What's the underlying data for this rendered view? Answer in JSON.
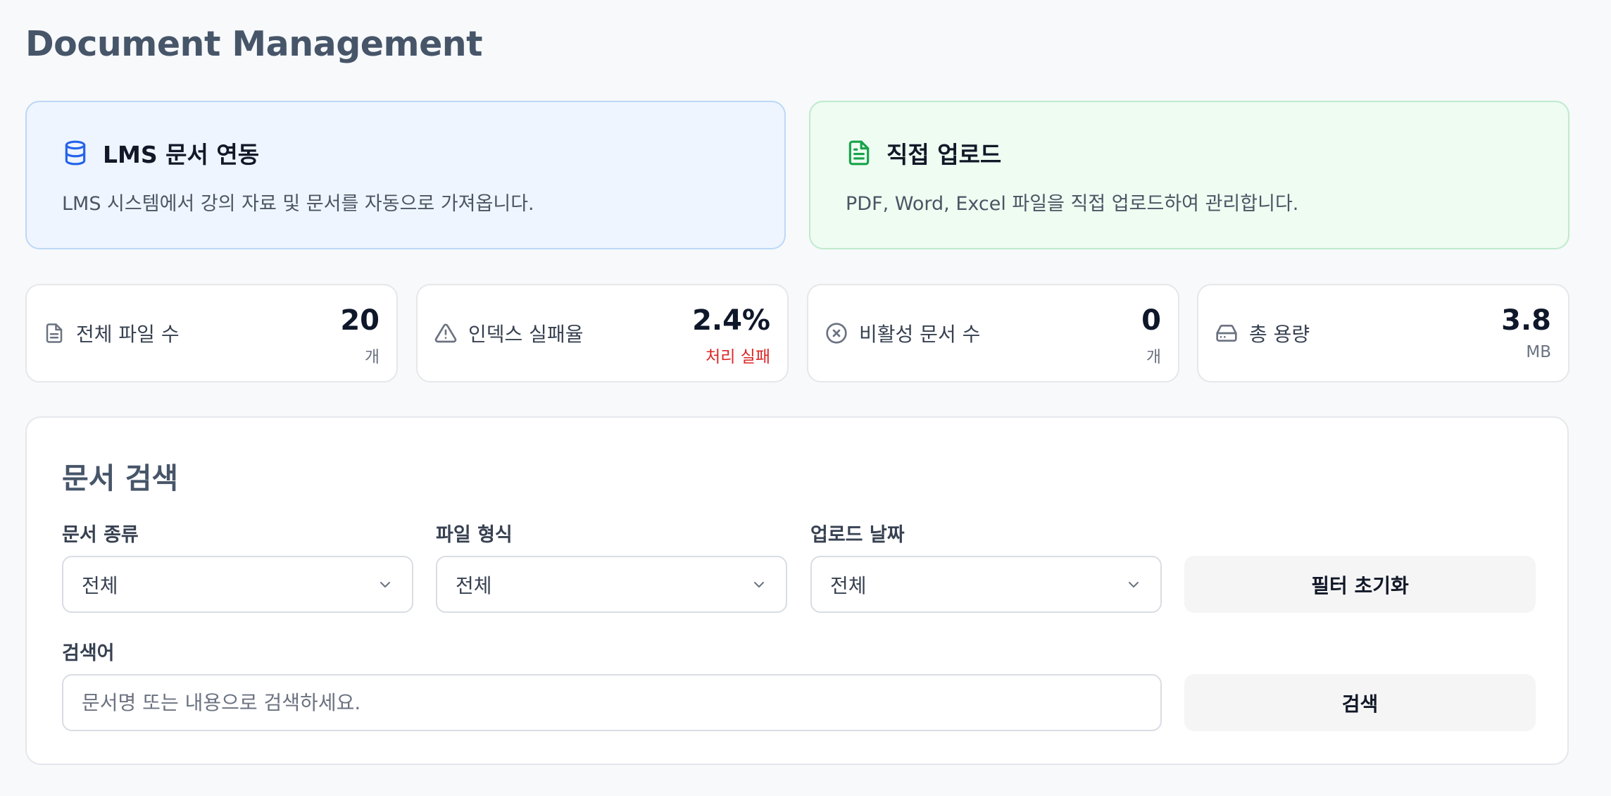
{
  "page": {
    "title": "Document Management"
  },
  "sources": {
    "lms": {
      "title": "LMS 문서 연동",
      "description": "LMS 시스템에서 강의 자료 및 문서를 자동으로 가져옵니다.",
      "icon": "database-icon",
      "accent": "#2563eb"
    },
    "upload": {
      "title": "직접 업로드",
      "description": "PDF, Word, Excel 파일을 직접 업로드하여 관리합니다.",
      "icon": "file-text-icon",
      "accent": "#16a34a"
    }
  },
  "stats": [
    {
      "label": "전체 파일 수",
      "value": "20",
      "unit": "개",
      "icon": "file-icon"
    },
    {
      "label": "인덱스 실패율",
      "value": "2.4%",
      "unit": "처리 실패",
      "icon": "alert-triangle-icon",
      "unit_color": "#dc2626"
    },
    {
      "label": "비활성 문서 수",
      "value": "0",
      "unit": "개",
      "icon": "x-circle-icon"
    },
    {
      "label": "총 용량",
      "value": "3.8",
      "unit": "MB",
      "icon": "hard-drive-icon"
    }
  ],
  "search": {
    "title": "문서 검색",
    "filters": {
      "doc_type": {
        "label": "문서 종류",
        "value": "전체"
      },
      "file_format": {
        "label": "파일 형식",
        "value": "전체"
      },
      "upload_date": {
        "label": "업로드 날짜",
        "value": "전체"
      }
    },
    "reset_label": "필터 초기화",
    "keyword_label": "검색어",
    "keyword_placeholder": "문서명 또는 내용으로 검색하세요.",
    "keyword_value": "",
    "submit_label": "검색"
  }
}
